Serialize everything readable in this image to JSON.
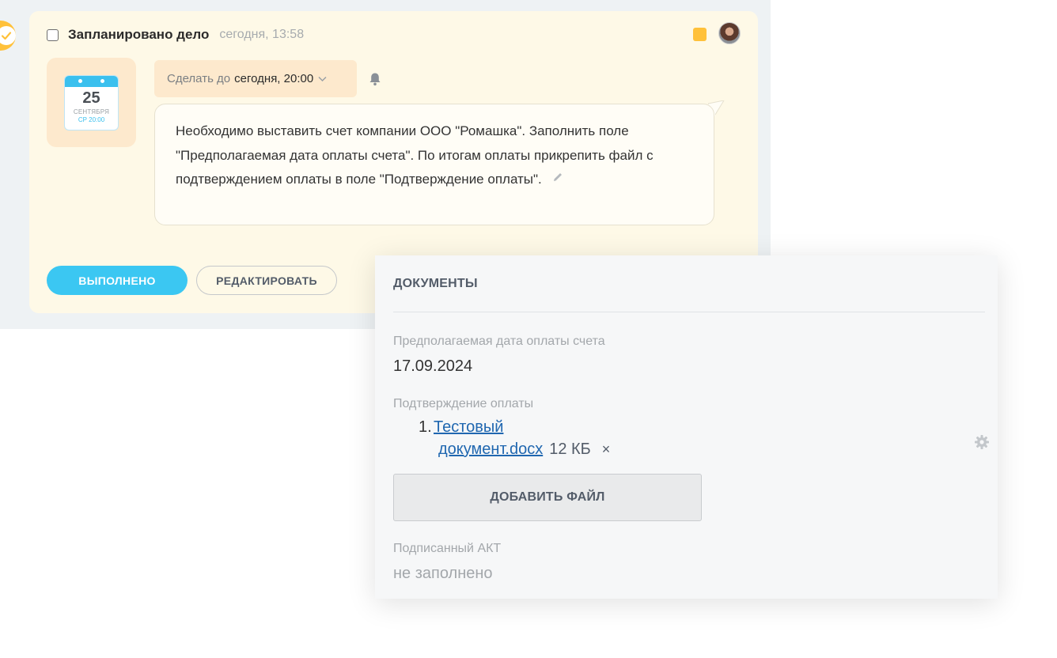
{
  "task": {
    "title": "Запланировано дело",
    "created_time": "сегодня, 13:58",
    "calendar": {
      "day": "25",
      "month": "СЕНТЯБРЯ",
      "weekday_time": "СР 20:00"
    },
    "deadline_prefix": "Сделать до",
    "deadline_value": "сегодня, 20:00",
    "description": "Необходимо выставить счет компании ООО \"Ромашка\". Заполнить поле \"Предполагаемая дата оплаты счета\". По итогам оплаты прикрепить файл с подтверждением оплаты в поле \"Подтверждение оплаты\".",
    "done_label": "ВЫПОЛНЕНО",
    "edit_label": "РЕДАКТИРОВАТЬ",
    "flag_color": "#ffc13a"
  },
  "documents": {
    "title": "ДОКУМЕНТЫ",
    "fields": [
      {
        "label": "Предполагаемая дата оплаты счета",
        "value": "17.09.2024"
      },
      {
        "label": "Подтверждение оплаты",
        "file": {
          "index": "1.",
          "name_line1": "Тестовый",
          "name_line2": "документ.docx",
          "size": "12 КБ",
          "remove": "×"
        }
      },
      {
        "label": "Подписанный АКТ",
        "value": "не заполнено"
      }
    ],
    "add_file_label": "ДОБАВИТЬ ФАЙЛ"
  },
  "colors": {
    "accent": "#3bc7f2",
    "card_bg": "#fef9e7",
    "link": "#2067b0"
  }
}
